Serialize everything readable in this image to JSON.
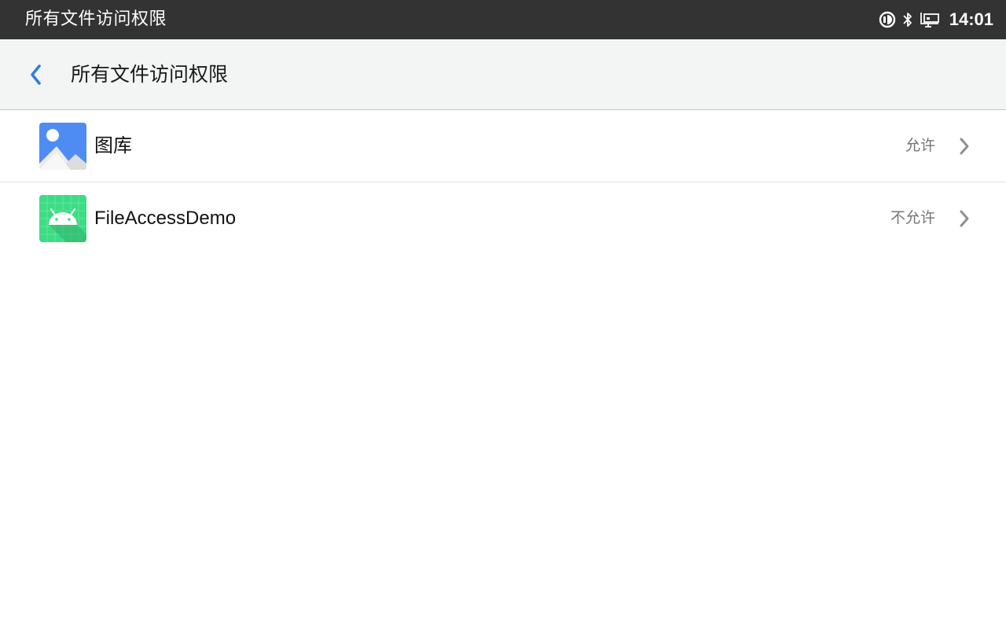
{
  "status_bar": {
    "title": "所有文件访问权限",
    "time": "14:01",
    "icons": [
      "data-saver-icon",
      "bluetooth-icon",
      "ethernet-icon"
    ]
  },
  "app_bar": {
    "back_icon": "chevron-left-icon",
    "title": "所有文件访问权限"
  },
  "apps": [
    {
      "name": "图库",
      "status": "允许",
      "icon": "gallery-icon"
    },
    {
      "name": "FileAccessDemo",
      "status": "不允许",
      "icon": "android-app-icon"
    }
  ],
  "colors": {
    "status_bar_bg": "#333333",
    "app_bar_bg": "#f3f4f4",
    "accent": "#2f7fd8",
    "secondary_text": "#757575"
  }
}
